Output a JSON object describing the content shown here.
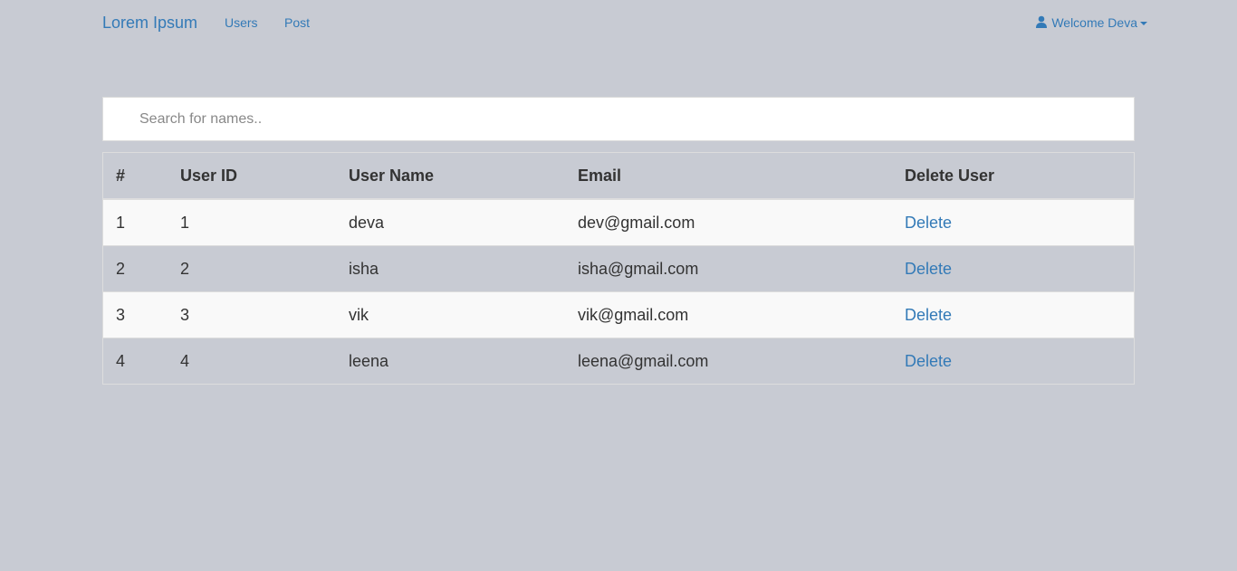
{
  "nav": {
    "brand": "Lorem Ipsum",
    "links": [
      "Users",
      "Post"
    ],
    "user_menu": "Welcome Deva"
  },
  "search": {
    "placeholder": "Search for names..",
    "value": ""
  },
  "table": {
    "headers": [
      "#",
      "User ID",
      "User Name",
      "Email",
      "Delete User"
    ],
    "rows": [
      {
        "index": "1",
        "user_id": "1",
        "user_name": "deva",
        "email": "dev@gmail.com",
        "action": "Delete"
      },
      {
        "index": "2",
        "user_id": "2",
        "user_name": "isha",
        "email": "isha@gmail.com",
        "action": "Delete"
      },
      {
        "index": "3",
        "user_id": "3",
        "user_name": "vik",
        "email": "vik@gmail.com",
        "action": "Delete"
      },
      {
        "index": "4",
        "user_id": "4",
        "user_name": "leena",
        "email": "leena@gmail.com",
        "action": "Delete"
      }
    ]
  },
  "colors": {
    "background": "#c8cbd3",
    "link": "#337ab7",
    "stripe": "#f9f9f9"
  },
  "icons": {
    "user_menu": "user-icon",
    "dropdown": "caret-down-icon"
  }
}
